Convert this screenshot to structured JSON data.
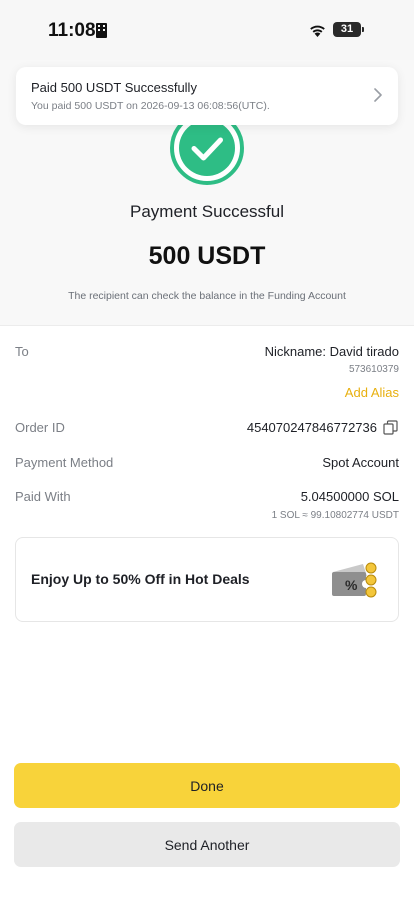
{
  "status_bar": {
    "time": "11:08",
    "battery": "31"
  },
  "notification": {
    "title": "Paid 500 USDT Successfully",
    "subtitle": "You paid 500 USDT on 2026-09-13 06:08:56(UTC)."
  },
  "result": {
    "title": "Payment Successful",
    "amount": "500 USDT",
    "note": "The recipient can check the balance in the Funding Account"
  },
  "details": {
    "to_label": "To",
    "to_value": "Nickname: David tirado",
    "to_id": "573610379",
    "add_alias": "Add Alias",
    "order_label": "Order ID",
    "order_value": "454070247846772736",
    "method_label": "Payment Method",
    "method_value": "Spot Account",
    "paid_label": "Paid With",
    "paid_value": "5.04500000 SOL",
    "paid_rate": "1 SOL ≈ 99.10802774 USDT"
  },
  "promo": {
    "text": "Enjoy Up to 50% Off in Hot Deals"
  },
  "buttons": {
    "done": "Done",
    "send_another": "Send Another"
  },
  "colors": {
    "accent": "#f8d33a",
    "success": "#2ebd85",
    "link": "#e8b00f"
  }
}
